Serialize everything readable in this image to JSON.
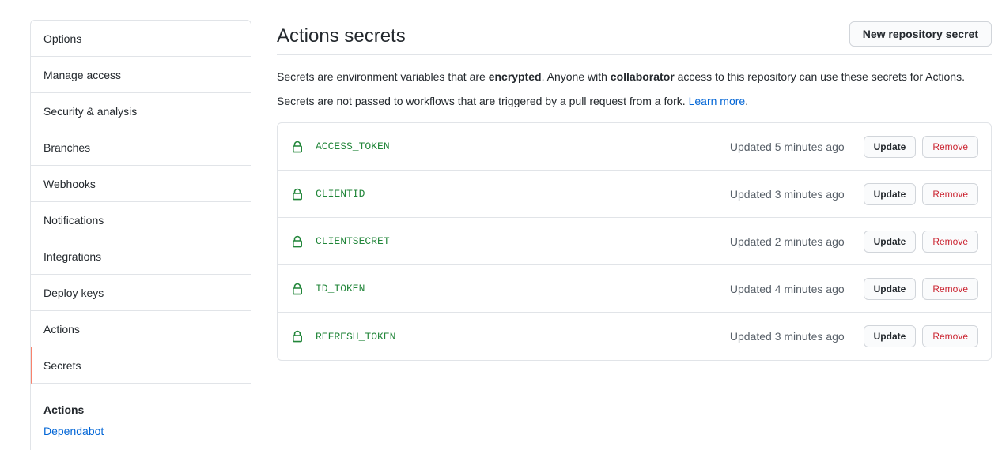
{
  "sidebar": {
    "items": [
      {
        "label": "Options"
      },
      {
        "label": "Manage access"
      },
      {
        "label": "Security & analysis"
      },
      {
        "label": "Branches"
      },
      {
        "label": "Webhooks"
      },
      {
        "label": "Notifications"
      },
      {
        "label": "Integrations"
      },
      {
        "label": "Deploy keys"
      },
      {
        "label": "Actions"
      },
      {
        "label": "Secrets",
        "selected": true
      }
    ],
    "section": {
      "heading": "Actions",
      "link": "Dependabot"
    }
  },
  "main": {
    "title": "Actions secrets",
    "new_button": "New repository secret",
    "desc1": {
      "t1": "Secrets are environment variables that are ",
      "b1": "encrypted",
      "t2": ". Anyone with ",
      "b2": "collaborator",
      "t3": " access to this repository can use these secrets for Actions."
    },
    "desc2": {
      "t1": "Secrets are not passed to workflows that are triggered by a pull request from a fork. ",
      "link": "Learn more",
      "t2": "."
    },
    "secrets": [
      {
        "name": "ACCESS_TOKEN",
        "updated": "Updated 5 minutes ago"
      },
      {
        "name": "CLIENTID",
        "updated": "Updated 3 minutes ago"
      },
      {
        "name": "CLIENTSECRET",
        "updated": "Updated 2 minutes ago"
      },
      {
        "name": "ID_TOKEN",
        "updated": "Updated 4 minutes ago"
      },
      {
        "name": "REFRESH_TOKEN",
        "updated": "Updated 3 minutes ago"
      }
    ],
    "update_label": "Update",
    "remove_label": "Remove"
  },
  "colors": {
    "accent_selected": "#f9826c",
    "secret_name": "#22863a",
    "link": "#0366d6",
    "danger": "#cb2431"
  },
  "icons": {
    "secret_row": "lock-icon"
  }
}
